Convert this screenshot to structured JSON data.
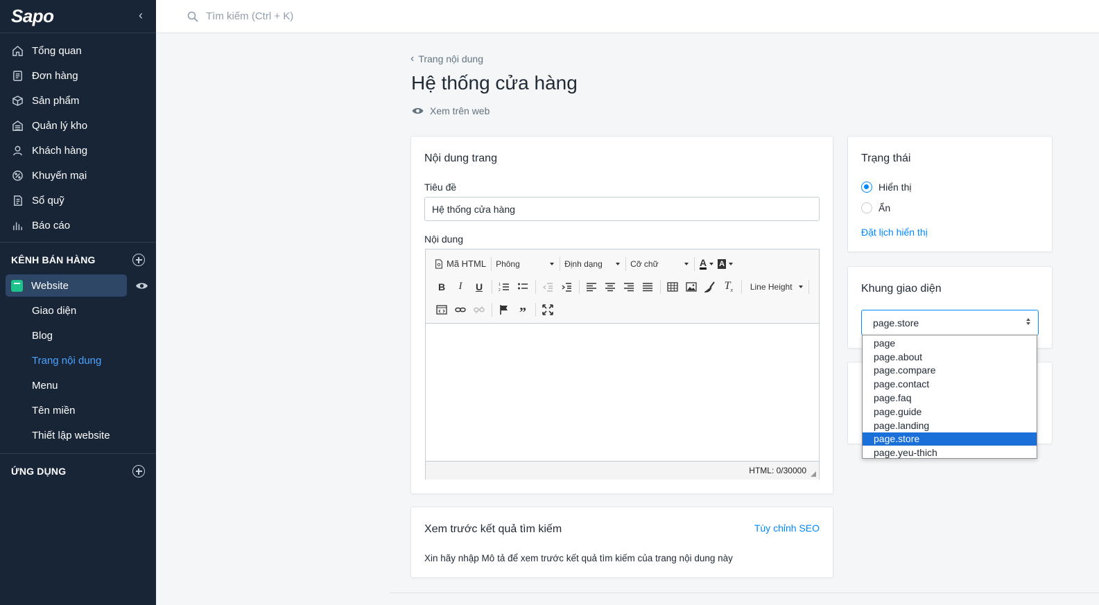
{
  "app": {
    "logo": "Sapo"
  },
  "search": {
    "placeholder": "Tìm kiếm (Ctrl + K)"
  },
  "sidebar": {
    "main_items": [
      {
        "label": "Tổng quan",
        "icon": "home-icon"
      },
      {
        "label": "Đơn hàng",
        "icon": "orders-icon"
      },
      {
        "label": "Sản phẩm",
        "icon": "box-icon"
      },
      {
        "label": "Quản lý kho",
        "icon": "warehouse-icon"
      },
      {
        "label": "Khách hàng",
        "icon": "user-icon"
      },
      {
        "label": "Khuyến mại",
        "icon": "discount-icon"
      },
      {
        "label": "Sổ quỹ",
        "icon": "cashbook-icon"
      },
      {
        "label": "Báo cáo",
        "icon": "report-icon"
      }
    ],
    "sales_channel_heading": "KÊNH BÁN HÀNG",
    "website_label": "Website",
    "website_sub": [
      "Giao diện",
      "Blog",
      "Trang nội dung",
      "Menu",
      "Tên miền",
      "Thiết lập website"
    ],
    "apps_heading": "ỨNG DỤNG"
  },
  "header": {
    "breadcrumb": "Trang nội dung",
    "title": "Hệ thống cửa hàng",
    "view_on_web": "Xem trên web"
  },
  "content_card": {
    "title": "Nội dung trang",
    "title_label": "Tiêu đề",
    "title_value": "Hệ thống cửa hàng",
    "content_label": "Nội dung",
    "toolbar": {
      "html_btn": "Mã HTML",
      "font_drop": "Phông",
      "format_drop": "Định dạng",
      "size_drop": "Cỡ chữ",
      "line_height_drop": "Line Height"
    },
    "html_counter": "HTML: 0/30000"
  },
  "seo_card": {
    "title": "Xem trước kết quả tìm kiếm",
    "customize_link": "Tùy chỉnh SEO",
    "hint": "Xin hãy nhập Mô tả để xem trước kết quả tìm kiếm của trang nội dung này"
  },
  "status_card": {
    "title": "Trạng thái",
    "option_show": "Hiển thị",
    "option_hide": "Ẩn",
    "selected": "Hiển thị",
    "schedule_link": "Đặt lịch hiển thị"
  },
  "template_card": {
    "title": "Khung giao diện",
    "selected": "page.store",
    "options": [
      "page",
      "page.about",
      "page.compare",
      "page.contact",
      "page.faq",
      "page.guide",
      "page.landing",
      "page.store",
      "page.yeu-thich"
    ]
  },
  "colors": {
    "sidebar_bg": "#182537",
    "accent": "#0088ff",
    "active_link": "#4aa3ff",
    "website_icon": "#1ec38b",
    "dropdown_highlight": "#1a6fd8"
  }
}
